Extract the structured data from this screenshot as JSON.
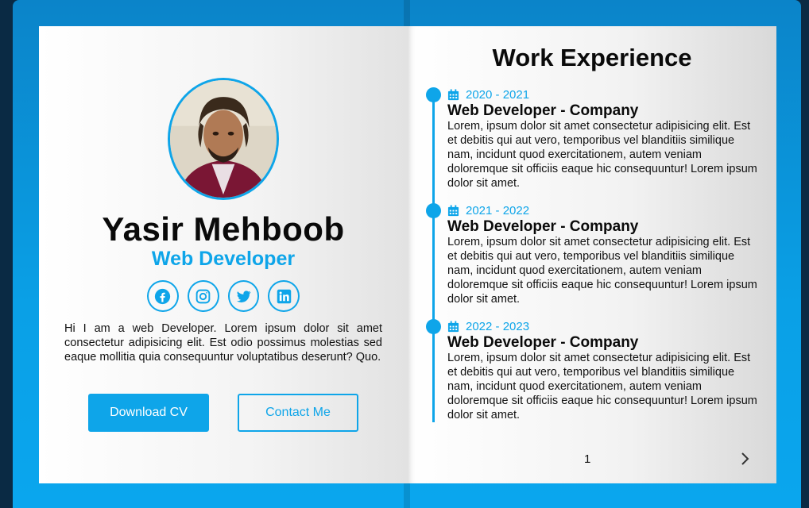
{
  "profile": {
    "name": "Yasir Mehboob",
    "role": "Web Developer",
    "bio": "Hi I am a web Developer. Lorem ipsum dolor sit amet consectetur adipisicing elit. Est odio possimus molestias sed eaque mollitia quia consequuntur voluptatibus deserunt? Quo.",
    "socials": [
      {
        "icon": "facebook-icon"
      },
      {
        "icon": "instagram-icon"
      },
      {
        "icon": "twitter-icon"
      },
      {
        "icon": "linkedin-icon"
      }
    ],
    "download_label": "Download CV",
    "contact_label": "Contact Me"
  },
  "experience": {
    "title": "Work Experience",
    "items": [
      {
        "date": "2020 - 2021",
        "heading": "Web Developer - Company",
        "text": "Lorem, ipsum dolor sit amet consectetur adipisicing elit. Est et debitis qui aut vero, temporibus vel blanditiis similique nam, incidunt quod exercitationem, autem veniam doloremque sit officiis eaque hic consequuntur! Lorem ipsum dolor sit amet."
      },
      {
        "date": "2021 - 2022",
        "heading": "Web Developer - Company",
        "text": "Lorem, ipsum dolor sit amet consectetur adipisicing elit. Est et debitis qui aut vero, temporibus vel blanditiis similique nam, incidunt quod exercitationem, autem veniam doloremque sit officiis eaque hic consequuntur! Lorem ipsum dolor sit amet."
      },
      {
        "date": "2022 - 2023",
        "heading": "Web Developer - Company",
        "text": "Lorem, ipsum dolor sit amet consectetur adipisicing elit. Est et debitis qui aut vero, temporibus vel blanditiis similique nam, incidunt quod exercitationem, autem veniam doloremque sit officiis eaque hic consequuntur! Lorem ipsum dolor sit amet."
      }
    ],
    "page_number": "1"
  },
  "colors": {
    "accent": "#0ea5e9",
    "cover": "#0aa0e6",
    "background": "#0a2a44"
  }
}
